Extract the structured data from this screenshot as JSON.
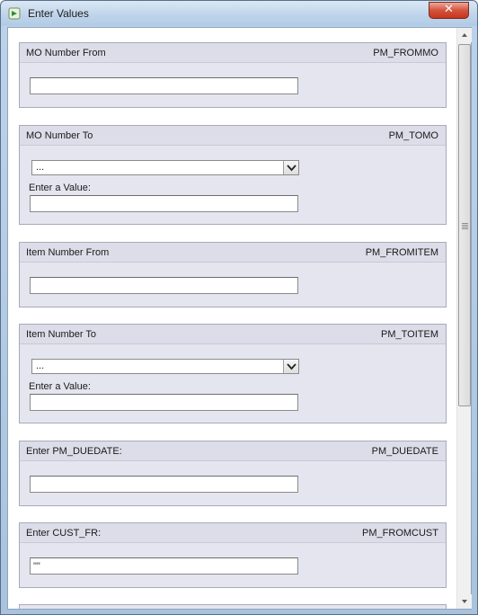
{
  "window": {
    "title": "Enter Values",
    "close_label": "✕"
  },
  "params": [
    {
      "label": "MO Number From",
      "code": "PM_FROMMO",
      "type": "text",
      "value": ""
    },
    {
      "label": "MO Number To",
      "code": "PM_TOMO",
      "type": "select",
      "select_value": "...",
      "enter_label": "Enter a Value:",
      "value": ""
    },
    {
      "label": "Item Number From",
      "code": "PM_FROMITEM",
      "type": "text",
      "value": ""
    },
    {
      "label": "Item Number To",
      "code": "PM_TOITEM",
      "type": "select",
      "select_value": "...",
      "enter_label": "Enter a Value:",
      "value": ""
    },
    {
      "label": "Enter PM_DUEDATE:",
      "code": "PM_DUEDATE",
      "type": "text",
      "value": ""
    },
    {
      "label": "Enter CUST_FR:",
      "code": "PM_FROMCUST",
      "type": "text",
      "value": "\"\""
    }
  ],
  "icons": {
    "app": "app-icon",
    "close": "close-icon",
    "dropdown": "chevron-down-icon",
    "scroll_up": "scroll-up-arrow-icon",
    "scroll_down": "scroll-down-arrow-icon"
  }
}
